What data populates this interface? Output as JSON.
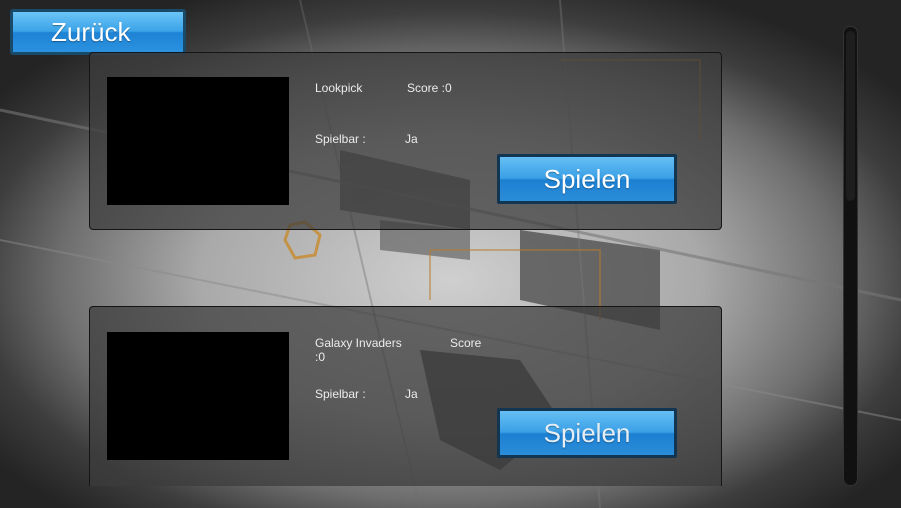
{
  "header": {
    "back_label": "Zurück"
  },
  "games": [
    {
      "name": "Lookpick",
      "score_label": "Score :0",
      "playable_label": "Spielbar :",
      "playable_value": "Ja",
      "play_label": "Spielen"
    },
    {
      "name": "Galaxy Invaders",
      "score_label": "Score",
      "score_value": ":0",
      "playable_label": "Spielbar :",
      "playable_value": "Ja",
      "play_label": "Spielen"
    }
  ],
  "colors": {
    "button_blue": "#3aa3e8",
    "panel": "#3c3c3c",
    "thumbnail": "#000000"
  }
}
